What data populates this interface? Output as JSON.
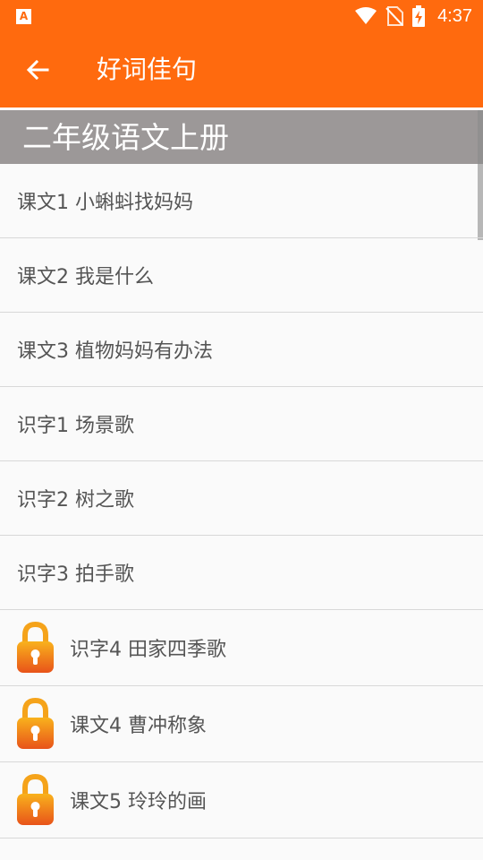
{
  "status_bar": {
    "time": "4:37",
    "left_icon": "A",
    "icons": [
      "wifi-icon",
      "no-sim-icon",
      "battery-charging-icon"
    ]
  },
  "app_bar": {
    "title": "好词佳句",
    "back_icon": "arrow-left-icon"
  },
  "section": {
    "title": "二年级语文上册"
  },
  "list": {
    "items": [
      {
        "label": "课文1 小蝌蚪找妈妈",
        "locked": false
      },
      {
        "label": "课文2 我是什么",
        "locked": false
      },
      {
        "label": "课文3 植物妈妈有办法",
        "locked": false
      },
      {
        "label": "识字1 场景歌",
        "locked": false
      },
      {
        "label": "识字2 树之歌",
        "locked": false
      },
      {
        "label": "识字3 拍手歌",
        "locked": false
      },
      {
        "label": "识字4 田家四季歌",
        "locked": true
      },
      {
        "label": "课文4 曹冲称象",
        "locked": true
      },
      {
        "label": "课文5 玲玲的画",
        "locked": true
      }
    ]
  },
  "colors": {
    "primary": "#ff6a0e",
    "section_bg": "#9c9898",
    "lock_top": "#f7a21a",
    "lock_bottom": "#e8581a"
  }
}
